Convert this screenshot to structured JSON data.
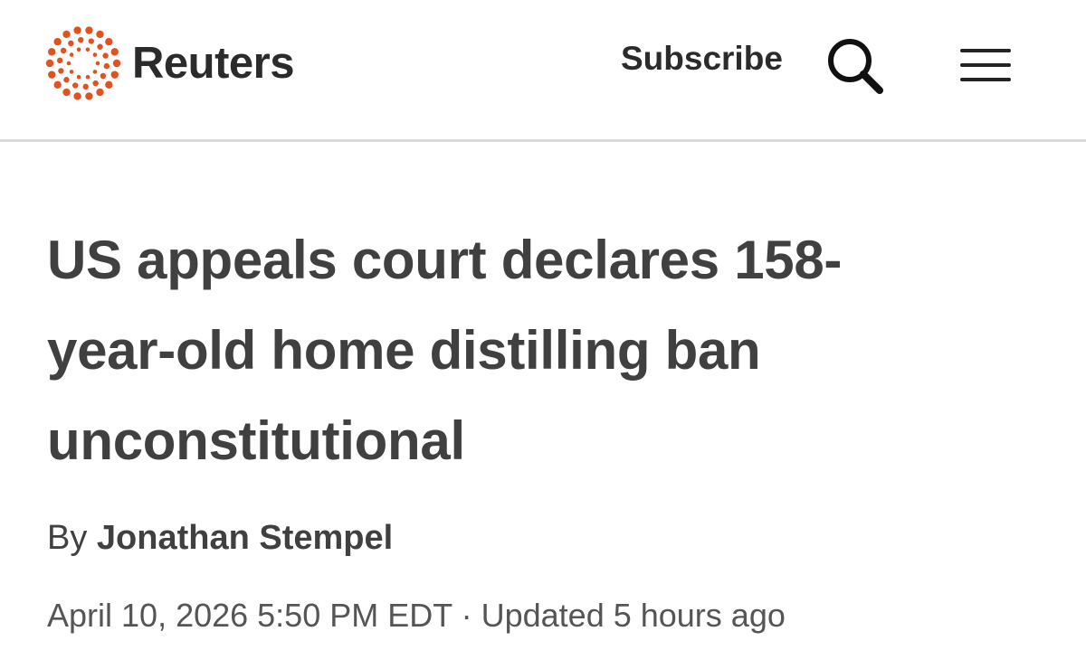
{
  "header": {
    "brand_name": "Reuters",
    "brand_color": "#e0531f",
    "subscribe_label": "Subscribe",
    "search_icon": "search-icon",
    "menu_icon": "hamburger-menu-icon"
  },
  "article": {
    "headline": "US appeals court declares 158-year-old home distilling ban unconstitutional",
    "byline_prefix": "By",
    "author": "Jonathan Stempel",
    "published": "April 10, 2026 5:50 PM EDT",
    "separator": "·",
    "updated": "Updated 5 hours ago"
  }
}
